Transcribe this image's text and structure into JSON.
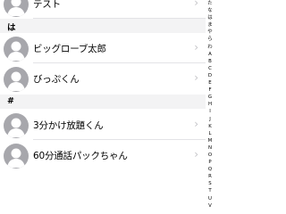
{
  "contacts_top": [
    {
      "name": "テスト"
    }
  ],
  "sections": [
    {
      "header": "は",
      "contacts": [
        {
          "name": "ビッグローブ太郎"
        },
        {
          "name": "びっぷくん"
        }
      ]
    },
    {
      "header": "#",
      "contacts": [
        {
          "name": "3分かけ放題くん"
        },
        {
          "name": "60分通話パックちゃん"
        }
      ]
    }
  ],
  "chevron_glyph": "›",
  "index_letters": [
    "た",
    "な",
    "は",
    "ま",
    "や",
    "ら",
    "わ",
    "A",
    "B",
    "C",
    "D",
    "E",
    "F",
    "G",
    "H",
    "I",
    "J",
    "K",
    "L",
    "M",
    "N",
    "O",
    "P",
    "Q",
    "R",
    "S",
    "T",
    "U",
    "V"
  ],
  "colors": {
    "avatar_gray": "#a7a7ac",
    "section_bg": "#f3f3f4",
    "separator": "#e3e3e6",
    "chevron": "#c4c4c7"
  },
  "icons": {
    "avatar": "person-silhouette-icon",
    "chevron": "chevron-right-icon"
  }
}
